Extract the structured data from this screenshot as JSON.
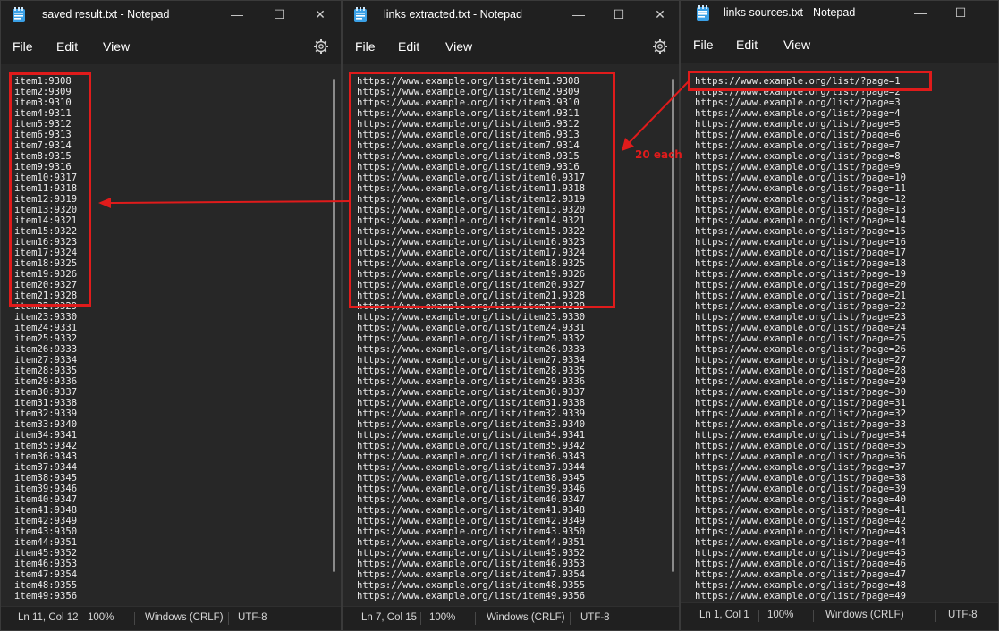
{
  "windows": [
    {
      "title": "saved result.txt - Notepad",
      "menu": [
        "File",
        "Edit",
        "View"
      ],
      "lines": [
        "item1:9308",
        "item2:9309",
        "item3:9310",
        "item4:9311",
        "item5:9312",
        "item6:9313",
        "item7:9314",
        "item8:9315",
        "item9:9316",
        "item10:9317",
        "item11:9318",
        "item12:9319",
        "item13:9320",
        "item14:9321",
        "item15:9322",
        "item16:9323",
        "item17:9324",
        "item18:9325",
        "item19:9326",
        "item20:9327",
        "item21:9328",
        "item22:9329",
        "item23:9330",
        "item24:9331",
        "item25:9332",
        "item26:9333",
        "item27:9334",
        "item28:9335",
        "item29:9336",
        "item30:9337",
        "item31:9338",
        "item32:9339",
        "item33:9340",
        "item34:9341",
        "item35:9342",
        "item36:9343",
        "item37:9344",
        "item38:9345",
        "item39:9346",
        "item40:9347",
        "item41:9348",
        "item42:9349",
        "item43:9350",
        "item44:9351",
        "item45:9352",
        "item46:9353",
        "item47:9354",
        "item48:9355",
        "item49:9356"
      ],
      "status": {
        "position": "Ln 11, Col 12",
        "zoom": "100%",
        "line_ending": "Windows (CRLF)",
        "encoding": "UTF-8"
      }
    },
    {
      "title": "links extracted.txt - Notepad",
      "menu": [
        "File",
        "Edit",
        "View"
      ],
      "lines": [
        "https://www.example.org/list/item1.9308",
        "https://www.example.org/list/item2.9309",
        "https://www.example.org/list/item3.9310",
        "https://www.example.org/list/item4.9311",
        "https://www.example.org/list/item5.9312",
        "https://www.example.org/list/item6.9313",
        "https://www.example.org/list/item7.9314",
        "https://www.example.org/list/item8.9315",
        "https://www.example.org/list/item9.9316",
        "https://www.example.org/list/item10.9317",
        "https://www.example.org/list/item11.9318",
        "https://www.example.org/list/item12.9319",
        "https://www.example.org/list/item13.9320",
        "https://www.example.org/list/item14.9321",
        "https://www.example.org/list/item15.9322",
        "https://www.example.org/list/item16.9323",
        "https://www.example.org/list/item17.9324",
        "https://www.example.org/list/item18.9325",
        "https://www.example.org/list/item19.9326",
        "https://www.example.org/list/item20.9327",
        "https://www.example.org/list/item21.9328",
        "https://www.example.org/list/item22.9329",
        "https://www.example.org/list/item23.9330",
        "https://www.example.org/list/item24.9331",
        "https://www.example.org/list/item25.9332",
        "https://www.example.org/list/item26.9333",
        "https://www.example.org/list/item27.9334",
        "https://www.example.org/list/item28.9335",
        "https://www.example.org/list/item29.9336",
        "https://www.example.org/list/item30.9337",
        "https://www.example.org/list/item31.9338",
        "https://www.example.org/list/item32.9339",
        "https://www.example.org/list/item33.9340",
        "https://www.example.org/list/item34.9341",
        "https://www.example.org/list/item35.9342",
        "https://www.example.org/list/item36.9343",
        "https://www.example.org/list/item37.9344",
        "https://www.example.org/list/item38.9345",
        "https://www.example.org/list/item39.9346",
        "https://www.example.org/list/item40.9347",
        "https://www.example.org/list/item41.9348",
        "https://www.example.org/list/item42.9349",
        "https://www.example.org/list/item43.9350",
        "https://www.example.org/list/item44.9351",
        "https://www.example.org/list/item45.9352",
        "https://www.example.org/list/item46.9353",
        "https://www.example.org/list/item47.9354",
        "https://www.example.org/list/item48.9355",
        "https://www.example.org/list/item49.9356"
      ],
      "status": {
        "position": "Ln 7, Col 15",
        "zoom": "100%",
        "line_ending": "Windows (CRLF)",
        "encoding": "UTF-8"
      }
    },
    {
      "title": "links sources.txt - Notepad",
      "menu": [
        "File",
        "Edit",
        "View"
      ],
      "lines": [
        "https://www.example.org/list/?page=1",
        "https://www.example.org/list/?page=2",
        "https://www.example.org/list/?page=3",
        "https://www.example.org/list/?page=4",
        "https://www.example.org/list/?page=5",
        "https://www.example.org/list/?page=6",
        "https://www.example.org/list/?page=7",
        "https://www.example.org/list/?page=8",
        "https://www.example.org/list/?page=9",
        "https://www.example.org/list/?page=10",
        "https://www.example.org/list/?page=11",
        "https://www.example.org/list/?page=12",
        "https://www.example.org/list/?page=13",
        "https://www.example.org/list/?page=14",
        "https://www.example.org/list/?page=15",
        "https://www.example.org/list/?page=16",
        "https://www.example.org/list/?page=17",
        "https://www.example.org/list/?page=18",
        "https://www.example.org/list/?page=19",
        "https://www.example.org/list/?page=20",
        "https://www.example.org/list/?page=21",
        "https://www.example.org/list/?page=22",
        "https://www.example.org/list/?page=23",
        "https://www.example.org/list/?page=24",
        "https://www.example.org/list/?page=25",
        "https://www.example.org/list/?page=26",
        "https://www.example.org/list/?page=27",
        "https://www.example.org/list/?page=28",
        "https://www.example.org/list/?page=29",
        "https://www.example.org/list/?page=30",
        "https://www.example.org/list/?page=31",
        "https://www.example.org/list/?page=32",
        "https://www.example.org/list/?page=33",
        "https://www.example.org/list/?page=34",
        "https://www.example.org/list/?page=35",
        "https://www.example.org/list/?page=36",
        "https://www.example.org/list/?page=37",
        "https://www.example.org/list/?page=38",
        "https://www.example.org/list/?page=39",
        "https://www.example.org/list/?page=40",
        "https://www.example.org/list/?page=41",
        "https://www.example.org/list/?page=42",
        "https://www.example.org/list/?page=43",
        "https://www.example.org/list/?page=44",
        "https://www.example.org/list/?page=45",
        "https://www.example.org/list/?page=46",
        "https://www.example.org/list/?page=47",
        "https://www.example.org/list/?page=48",
        "https://www.example.org/list/?page=49"
      ],
      "status": {
        "position": "Ln 1, Col 1",
        "zoom": "100%",
        "line_ending": "Windows (CRLF)",
        "encoding": "UTF-8"
      }
    }
  ],
  "annotation": {
    "label": "20 each"
  },
  "colors": {
    "annotation_red": "#e01b1b",
    "editor_bg": "#272727",
    "chrome_bg": "#202020"
  }
}
